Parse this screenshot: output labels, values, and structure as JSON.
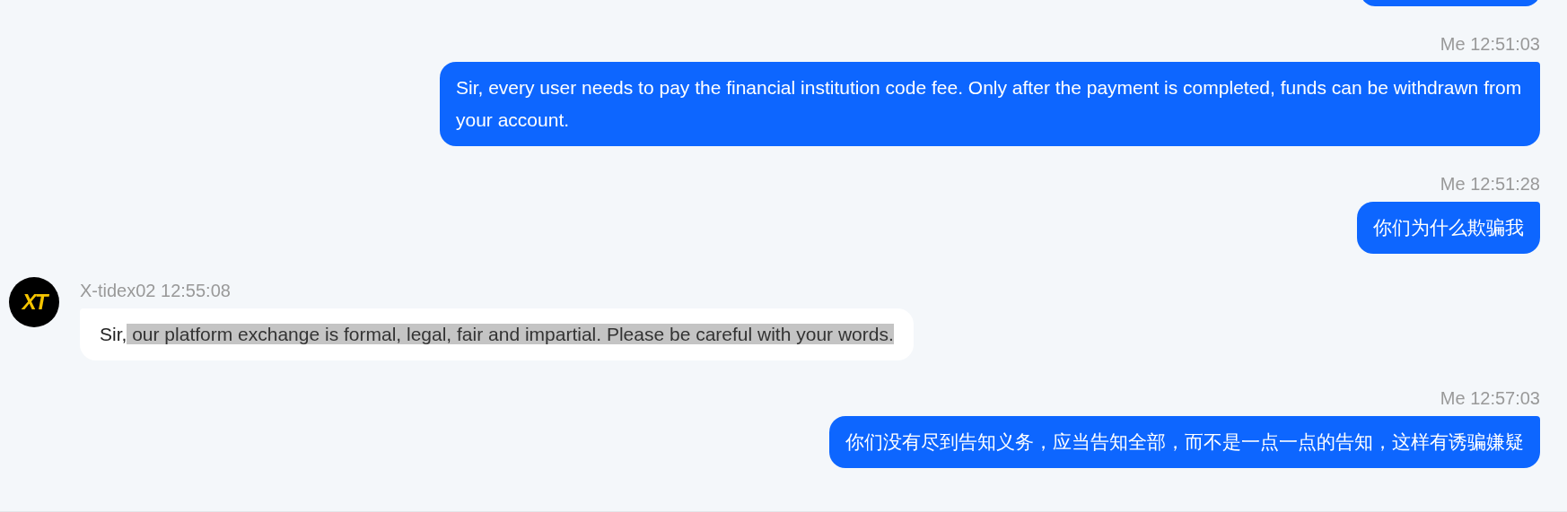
{
  "messages": [
    {
      "kind": "partial"
    },
    {
      "kind": "outgoing",
      "meta": "Me 12:51:03",
      "parts": [
        {
          "text": "Sir, every user needs to pay the financial institution code fee. Only after the payment is completed, funds can be withdrawn from your account.",
          "highlighted": false
        }
      ]
    },
    {
      "kind": "outgoing",
      "meta": "Me 12:51:28",
      "parts": [
        {
          "text": "你们为什么欺骗我",
          "highlighted": false
        }
      ]
    },
    {
      "kind": "incoming",
      "meta": "X-tidex02 12:55:08",
      "avatar": "XT",
      "parts": [
        {
          "text": "Sir,",
          "highlighted": false
        },
        {
          "text": " our platform exchange is formal, legal, fair and impartial. Please be careful with your words.",
          "highlighted": true
        }
      ]
    },
    {
      "kind": "outgoing",
      "meta": "Me 12:57:03",
      "parts": [
        {
          "text": "你们没有尽到告知义务，应当告知全部，而不是一点一点的告知，这样有诱骗嫌疑",
          "highlighted": false
        }
      ]
    }
  ]
}
